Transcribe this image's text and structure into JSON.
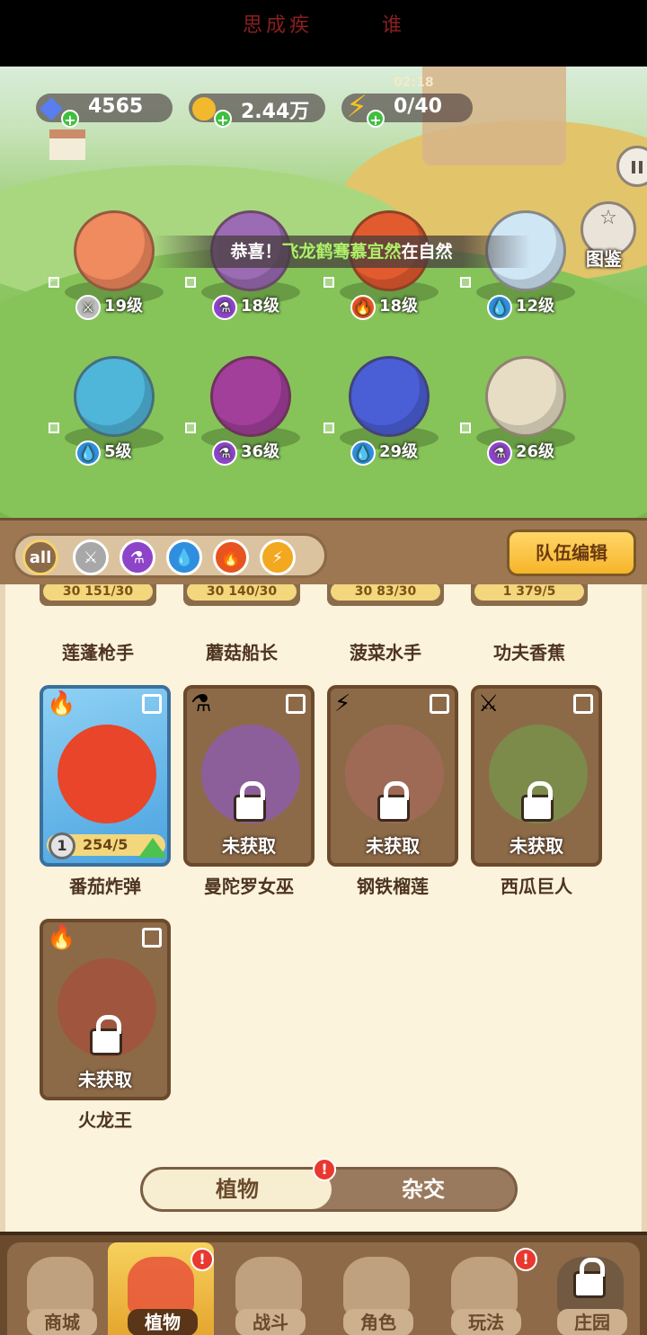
{
  "banner": {
    "text_left": "思成疾",
    "text_right": "谁"
  },
  "resources": {
    "gems": "4565",
    "coins": "2.44万",
    "energy": "0/40",
    "energy_timer": "02:18"
  },
  "scene": {
    "atlas_label": "图鉴",
    "ticker_prefix": "恭喜！",
    "ticker_name": "飞龙鹤骞慕宜然",
    "ticker_suffix": "在自然"
  },
  "team_plants": [
    {
      "level": "19级",
      "element": "sword-icon"
    },
    {
      "level": "18级",
      "element": "potion-icon"
    },
    {
      "level": "18级",
      "element": "fire-icon"
    },
    {
      "level": "12级",
      "element": "water-icon"
    },
    {
      "level": "5级",
      "element": "water-icon"
    },
    {
      "level": "36级",
      "element": "potion-icon"
    },
    {
      "level": "29级",
      "element": "water-icon"
    },
    {
      "level": "26级",
      "element": "potion-icon"
    }
  ],
  "filters": {
    "all_label": "all",
    "team_edit": "队伍编辑"
  },
  "top_row_cards": [
    {
      "name": "莲蓬枪手",
      "level": "30",
      "progress": "151/30"
    },
    {
      "name": "蘑菇船长",
      "level": "30",
      "progress": "140/30"
    },
    {
      "name": "菠菜水手",
      "level": "30",
      "progress": "83/30"
    },
    {
      "name": "功夫香蕉",
      "level": "1",
      "progress": "379/5"
    }
  ],
  "cards": [
    {
      "name": "番茄炸弹",
      "star": "1",
      "progress": "254/5",
      "status": ""
    },
    {
      "name": "曼陀罗女巫",
      "status": "未获取"
    },
    {
      "name": "钢铁榴莲",
      "status": "未获取"
    },
    {
      "name": "西瓜巨人",
      "status": "未获取"
    },
    {
      "name": "火龙王",
      "status": "未获取"
    }
  ],
  "switch": {
    "plants": "植物",
    "hybrid": "杂交",
    "badge": "!"
  },
  "nav": {
    "shop": "商城",
    "plants": "植物",
    "battle": "战斗",
    "role": "角色",
    "play": "玩法",
    "manor": "庄园",
    "badge": "!"
  },
  "colors": {
    "accent": "#f6b52a",
    "panel": "#fbf3dc",
    "frame": "#9c7752"
  }
}
